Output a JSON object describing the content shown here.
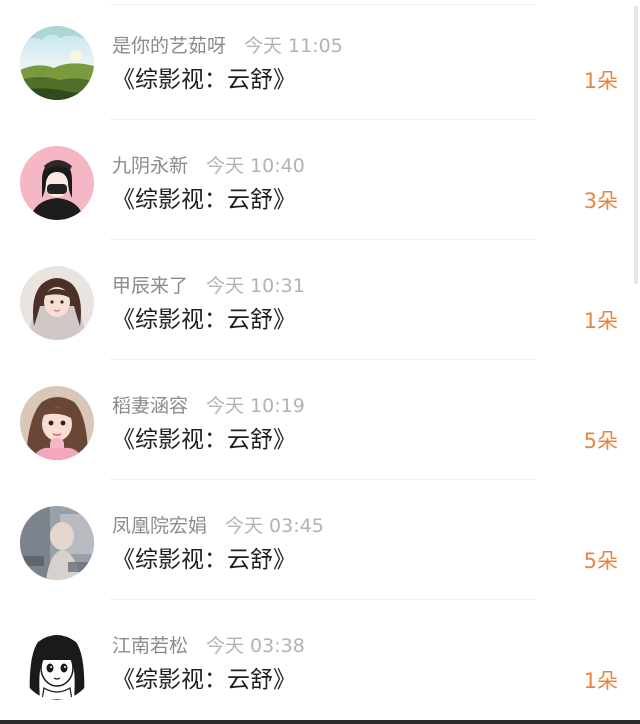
{
  "items": [
    {
      "name": "是你的艺茹呀",
      "time": "今天 11:05",
      "title": "《综影视：云舒》",
      "count": "1朵",
      "avatar_icon": "landscape-avatar-icon"
    },
    {
      "name": "九阴永新",
      "time": "今天 10:40",
      "title": "《综影视：云舒》",
      "count": "3朵",
      "avatar_icon": "masked-girl-avatar-icon"
    },
    {
      "name": "甲辰来了",
      "time": "今天 10:31",
      "title": "《综影视：云舒》",
      "count": "1朵",
      "avatar_icon": "girl-photo-avatar-icon"
    },
    {
      "name": "稻妻涵容",
      "time": "今天 10:19",
      "title": "《综影视：云舒》",
      "count": "5朵",
      "avatar_icon": "girl-photo-avatar-icon"
    },
    {
      "name": "凤凰院宏娟",
      "time": "今天 03:45",
      "title": "《综影视：云舒》",
      "count": "5朵",
      "avatar_icon": "blurred-photo-avatar-icon"
    },
    {
      "name": "江南若松",
      "time": "今天 03:38",
      "title": "《综影视：云舒》",
      "count": "1朵",
      "avatar_icon": "anime-girl-avatar-icon"
    }
  ],
  "colors": {
    "name": "#8b8b8b",
    "time": "#b3b3b3",
    "title": "#1f1f1f",
    "count": "#e8863c"
  }
}
